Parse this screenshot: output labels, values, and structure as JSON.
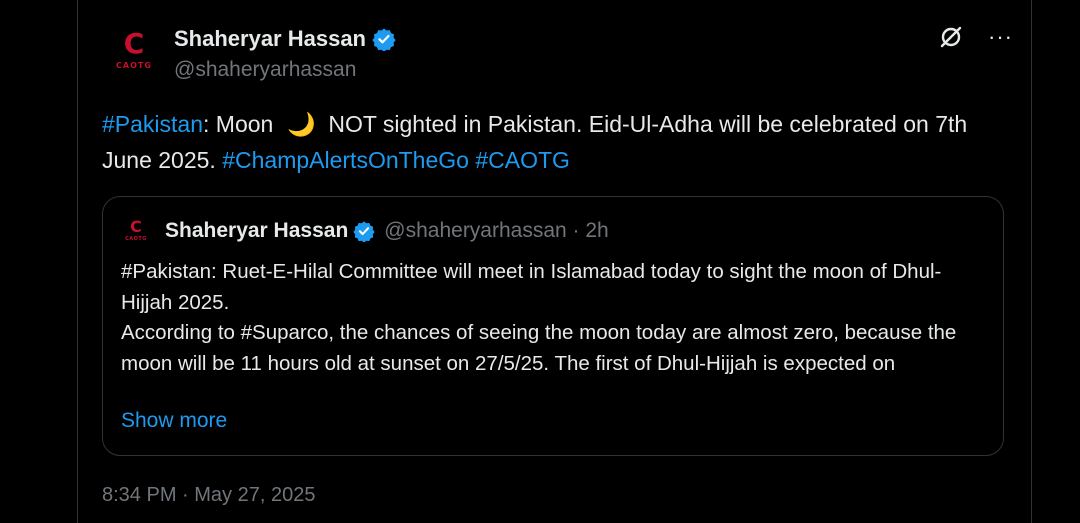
{
  "tweet": {
    "author_name": "Shaheryar Hassan",
    "author_handle": "@shaheryarhassan",
    "avatar_logo_text": "CAOTG",
    "text_parts": {
      "hashtag_pakistan": "#Pakistan",
      "part1": ": Moon",
      "moon_emoji": "🌙",
      "part2": "NOT sighted in Pakistan. Eid-Ul-Adha will be celebrated on 7th June 2025.",
      "hashtag_champ": "#ChampAlertsOnTheGo",
      "hashtag_caotg": "#CAOTG"
    },
    "timestamp": "8:34 PM · May 27, 2025"
  },
  "quote": {
    "author_name": "Shaheryar Hassan",
    "author_handle": "@shaheryarhassan · 2h",
    "line1": "#Pakistan: Ruet-E-Hilal Committee will meet in Islamabad today to sight the moon of Dhul-Hijjah 2025.",
    "line2": "According to #Suparco, the chances of seeing the moon today are almost zero, because the moon will be 11 hours old at sunset on 27/5/25. The first of Dhul-Hijjah is expected on",
    "show_more": "Show more"
  },
  "icons": {
    "verified": "verified-badge-icon",
    "grok": "grok-icon",
    "more": "more-icon"
  },
  "colors": {
    "background": "#000000",
    "link": "#1d9bf0",
    "secondary_text": "#71767b",
    "border": "#2f3336",
    "logo_red": "#c8102e"
  }
}
